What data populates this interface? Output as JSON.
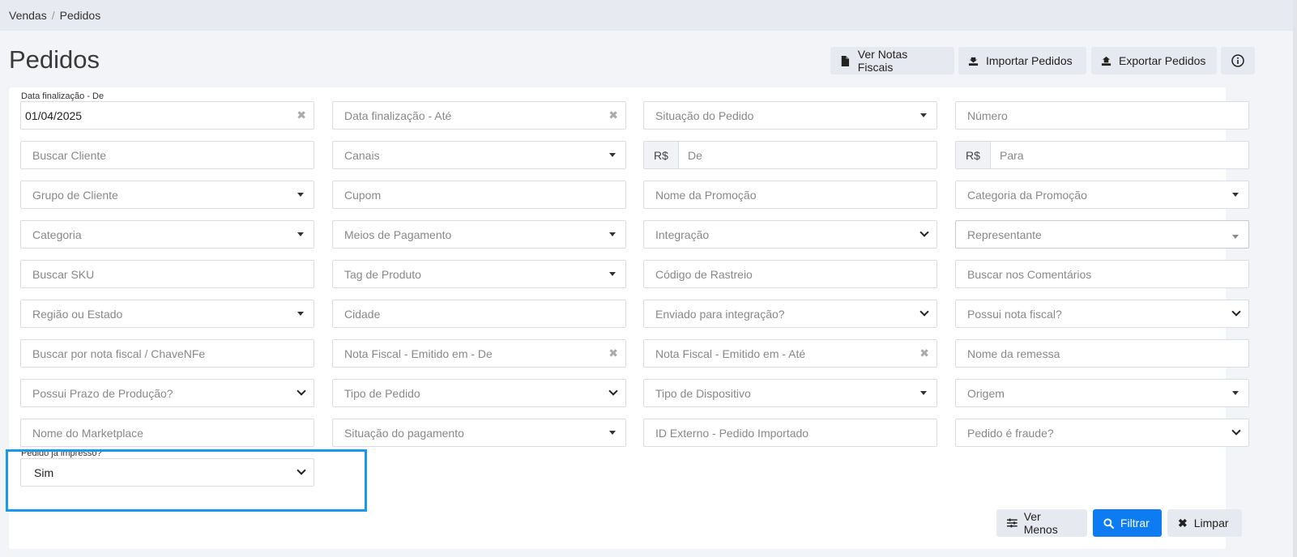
{
  "breadcrumb": {
    "parent": "Vendas",
    "separator": "/",
    "current": "Pedidos"
  },
  "page_title": "Pedidos",
  "header_buttons": {
    "notas": "Ver Notas Fiscais",
    "importar": "Importar Pedidos",
    "exportar": "Exportar Pedidos"
  },
  "filters": {
    "data_de": {
      "label": "Data finalização - De",
      "value": "01/04/2025"
    },
    "data_ate": "Data finalização - Até",
    "situacao_pedido": "Situação do Pedido",
    "numero": "Número",
    "buscar_cliente": "Buscar Cliente",
    "canais": "Canais",
    "currency": "R$",
    "valor_de": "De",
    "valor_para": "Para",
    "grupo_cliente": "Grupo de Cliente",
    "cupom": "Cupom",
    "nome_promocao": "Nome da Promoção",
    "categoria_promocao": "Categoria da Promoção",
    "categoria": "Categoria",
    "meios_pagamento": "Meios de Pagamento",
    "integracao": "Integração",
    "representante": "Representante",
    "buscar_sku": "Buscar SKU",
    "tag_produto": "Tag de Produto",
    "codigo_rastreio": "Código de Rastreio",
    "buscar_comentarios": "Buscar nos Comentários",
    "regiao_estado": "Região ou Estado",
    "cidade": "Cidade",
    "enviado_integracao": "Enviado para integração?",
    "possui_nota": "Possui nota fiscal?",
    "buscar_nota": "Buscar por nota fiscal / ChaveNFe",
    "nota_emitido_de": "Nota Fiscal - Emitido em - De",
    "nota_emitido_ate": "Nota Fiscal - Emitido em - Até",
    "nome_remessa": "Nome da remessa",
    "prazo_producao": "Possui Prazo de Produção?",
    "tipo_pedido": "Tipo de Pedido",
    "tipo_dispositivo": "Tipo de Dispositivo",
    "origem": "Origem",
    "nome_marketplace": "Nome do Marketplace",
    "situacao_pagamento": "Situação do pagamento",
    "id_externo": "ID Externo - Pedido Importado",
    "pedido_fraude": "Pedido é fraude?",
    "pedido_impresso": {
      "label": "Pedido já impresso?",
      "value": "Sim"
    }
  },
  "footer_buttons": {
    "ver_menos": "Ver Menos",
    "filtrar": "Filtrar",
    "limpar": "Limpar"
  },
  "colors": {
    "accent": "#0d7cf2",
    "highlight": "#1a99ec"
  }
}
